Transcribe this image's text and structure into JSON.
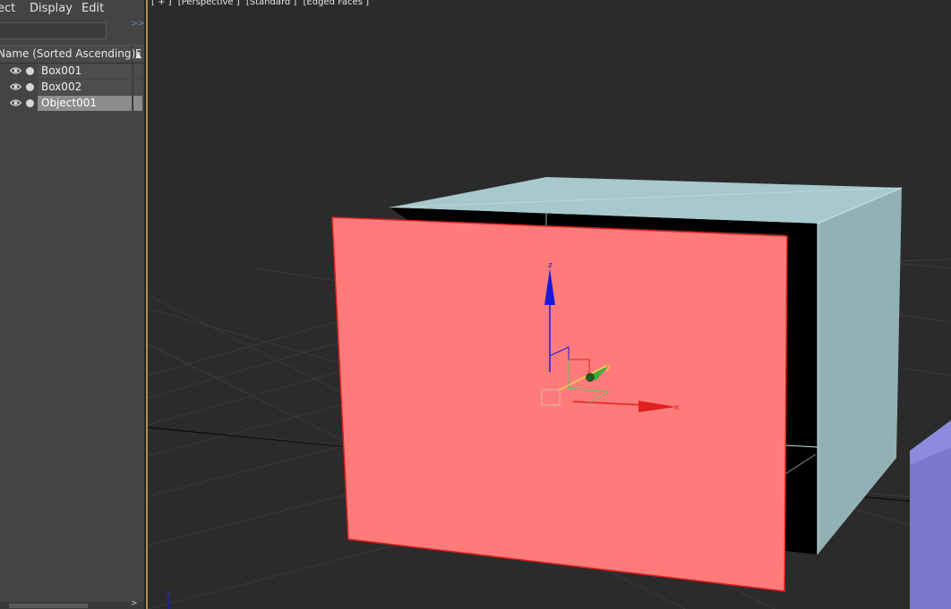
{
  "menu": {
    "select": "ect",
    "display": "Display",
    "edit": "Edit"
  },
  "search": {
    "placeholder": "",
    "expand_icon": ">>"
  },
  "columns": {
    "name": "Name (Sorted Ascending)",
    "sort_glyph": "▲",
    "second": "F"
  },
  "objects": [
    {
      "name": "Box001",
      "selected": false
    },
    {
      "name": "Box002",
      "selected": false
    },
    {
      "name": "Object001",
      "selected": true
    }
  ],
  "viewport": {
    "plus": "[ + ]",
    "view": "[Perspective ]",
    "shading": "[Standard ]",
    "display_mode": "[Edged Faces ]",
    "gizmo": {
      "x": "x",
      "y": "y",
      "z": "z"
    },
    "axis_tripod_z": "z"
  },
  "colors": {
    "viewport_bg": "#2b2b2b",
    "grid_line": "#3b3b3b",
    "plane_fill": "#ff7b7b",
    "plane_edge": "#e02020",
    "box_top": "#a7c8cc",
    "box_side": "#92b1b5",
    "box2_fill": "#7b79cf",
    "axis_x": "#e02020",
    "axis_y": "#5ec15e",
    "axis_z": "#1b1bd6",
    "selection_gold": "#b0903e"
  }
}
